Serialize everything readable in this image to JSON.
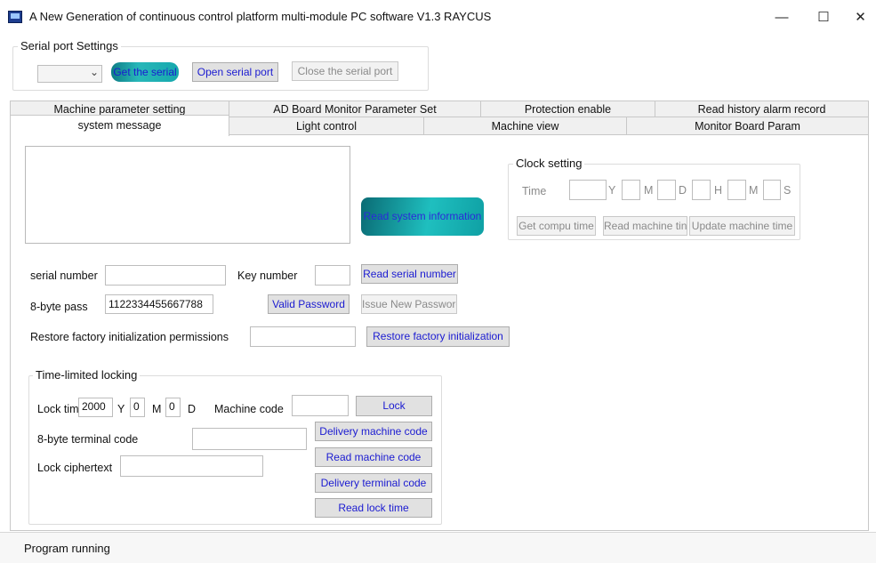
{
  "window": {
    "title": "A New Generation of continuous control platform multi-module PC software V1.3 RAYCUS",
    "minimize_glyph": "—",
    "maximize_glyph": "☐",
    "close_glyph": "✕"
  },
  "serial_port": {
    "legend": "Serial port Settings",
    "port_select_value": "",
    "chevron": "⌄",
    "get_serial_label": "Get the serial",
    "open_label": "Open serial port",
    "close_label": "Close the serial port"
  },
  "tabs": {
    "row1": [
      "Machine parameter setting",
      "AD Board Monitor Parameter Set",
      "Protection enable",
      "Read history alarm record"
    ],
    "row2": [
      "system message",
      "Light control",
      "Machine view",
      "Monitor Board Param"
    ]
  },
  "system": {
    "read_system_info_label": "Read system information",
    "message_text": ""
  },
  "clock": {
    "legend": "Clock setting",
    "time_label": "Time",
    "unit_y": "Y",
    "unit_m": "M",
    "unit_d": "D",
    "unit_h": "H",
    "unit_min": "M",
    "unit_s": "S",
    "get_computer_time_label": "Get compu time",
    "read_machine_time_label": "Read machine tin",
    "update_machine_time_label": "Update machine time"
  },
  "serial": {
    "serial_number_label": "serial number",
    "serial_number_value": "",
    "key_number_label": "Key number",
    "key_number_value": "",
    "read_serial_label": "Read serial number",
    "pass_label": "8-byte pass",
    "pass_value": "1122334455667788",
    "valid_password_label": "Valid Password",
    "issue_password_label": "Issue New Passworc",
    "restore_perm_label": "Restore factory initialization permissions",
    "restore_perm_value": "",
    "restore_button_label": "Restore factory initialization"
  },
  "lock": {
    "legend": "Time-limited locking",
    "lock_time_label": "Lock tim",
    "year_value": "2000",
    "unit_y": "Y",
    "month_value": "0",
    "unit_m": "M",
    "day_value": "0",
    "unit_d": "D",
    "machine_code_label": "Machine code",
    "machine_code_value": "",
    "lock_button_label": "Lock",
    "terminal_code_label": "8-byte terminal code",
    "terminal_code_value": "",
    "delivery_machine_code_label": "Delivery machine code",
    "read_machine_code_label": "Read machine code",
    "lock_cipher_label": "Lock ciphertext",
    "lock_cipher_value": "",
    "delivery_terminal_code_label": "Delivery terminal code",
    "read_lock_time_label": "Read lock time"
  },
  "status": {
    "text": "Program running"
  }
}
